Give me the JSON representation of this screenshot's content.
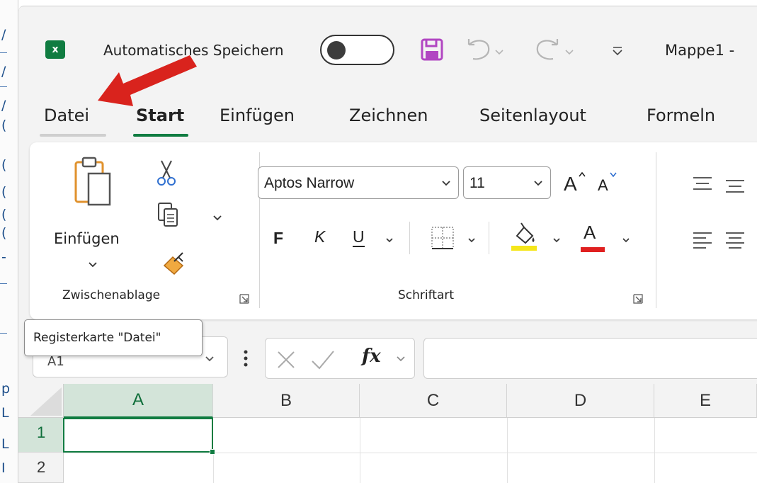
{
  "title_bar": {
    "app_icon": "excel-icon",
    "autosave_label": "Automatisches Speichern",
    "autosave_state": "off",
    "document_title": "Mappe1 -"
  },
  "tabs": [
    {
      "label": "Datei"
    },
    {
      "label": "Start",
      "active": true
    },
    {
      "label": "Einfügen"
    },
    {
      "label": "Zeichnen"
    },
    {
      "label": "Seitenlayout"
    },
    {
      "label": "Formeln"
    }
  ],
  "clipboard_group": {
    "paste_label": "Einfügen",
    "group_label": "Zwischenablage"
  },
  "font_group": {
    "font_name": "Aptos Narrow",
    "font_size": "11",
    "bold_label": "F",
    "italic_label": "K",
    "underline_label": "U",
    "font_color_label": "A",
    "group_label": "Schriftart",
    "grow_label": "A",
    "shrink_label": "A"
  },
  "tooltip": {
    "text": "Registerkarte \"Datei\""
  },
  "formula_bar": {
    "name_box_value": "A1",
    "fx_label": "fx",
    "formula_value": ""
  },
  "grid": {
    "columns": [
      "A",
      "B",
      "C",
      "D",
      "E"
    ],
    "rows": [
      "1",
      "2"
    ],
    "selected_cell": "A1"
  },
  "colors": {
    "excel_green": "#107c41",
    "fill_color": "#f5e61a",
    "font_color": "#e02020",
    "arrow": "#d9231d",
    "save_icon": "#b146c2"
  },
  "annotation": {
    "type": "arrow",
    "points_to": "tab-datei"
  }
}
